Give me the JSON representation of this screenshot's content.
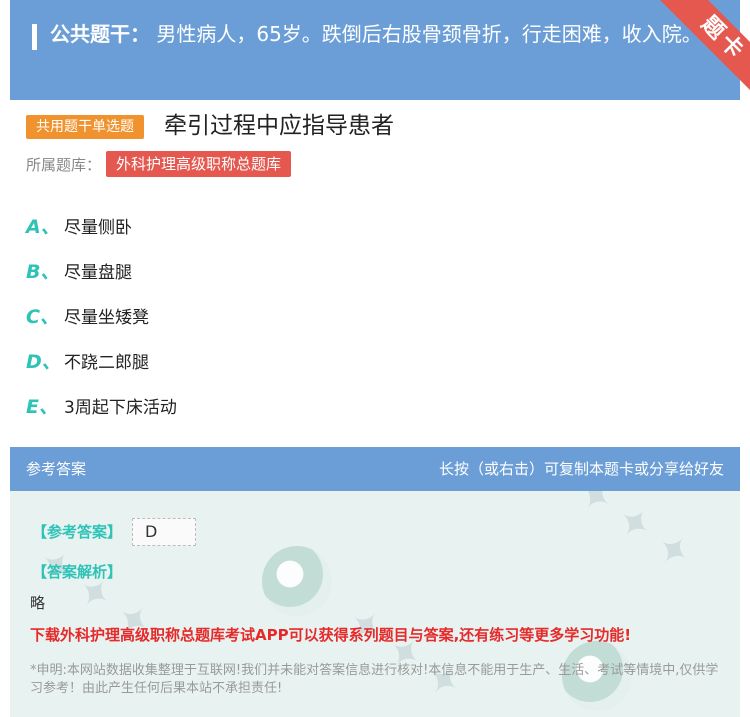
{
  "stem": {
    "label": "公共题干：",
    "text": "男性病人，65岁。跌倒后右股骨颈骨折，行走困难，收入院。"
  },
  "corner": {
    "text": "题卡"
  },
  "question": {
    "type_tag": "共用题干单选题",
    "title": "牵引过程中应指导患者",
    "bank_label": "所属题库：",
    "bank_name": "外科护理高级职称总题库"
  },
  "options": [
    {
      "letter": "A、",
      "text": "尽量侧卧"
    },
    {
      "letter": "B、",
      "text": "尽量盘腿"
    },
    {
      "letter": "C、",
      "text": "尽量坐矮凳"
    },
    {
      "letter": "D、",
      "text": "不跷二郎腿"
    },
    {
      "letter": "E、",
      "text": "3周起下床活动"
    }
  ],
  "answer": {
    "header_left": "参考答案",
    "header_right": "长按（或右击）可复制本题卡或分享给好友",
    "answer_label": "【参考答案】",
    "answer_value": "D",
    "explain_label": "【答案解析】",
    "explain_text": "略",
    "promo": "下载外科护理高级职称总题库考试APP可以获得系列题目与答案,还有练习等更多学习功能!",
    "disclaimer": "*申明:本网站数据收集整理于互联网!我们并未能对答案信息进行核对!本信息不能用于生产、生活、考试等情境中,仅供学习参考！由此产生任何后果本站不承担责任!"
  },
  "colors": {
    "header_blue": "#6b9ed6",
    "accent_teal": "#2fc2b7",
    "tag_orange": "#f0922e",
    "tag_red": "#e4584f",
    "promo_red": "#e62a2a"
  }
}
